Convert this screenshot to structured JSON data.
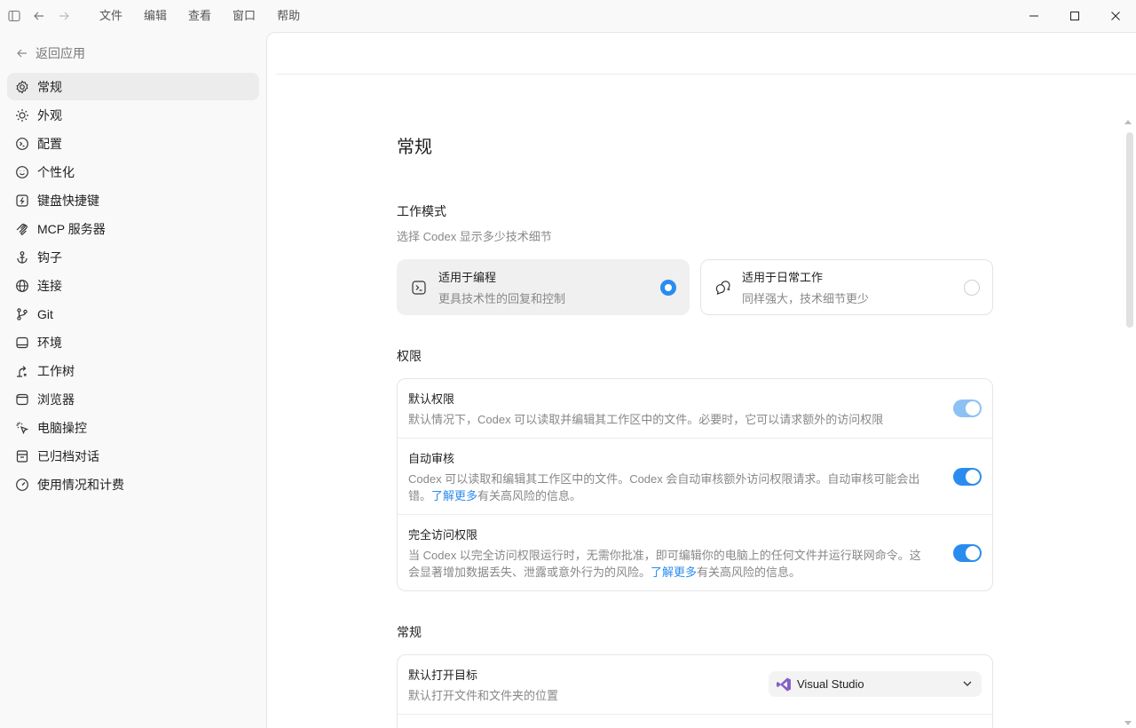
{
  "menu": [
    "文件",
    "编辑",
    "查看",
    "窗口",
    "帮助"
  ],
  "sidebar": {
    "back_label": "返回应用",
    "items": [
      {
        "label": "常规",
        "icon": "gear-icon"
      },
      {
        "label": "外观",
        "icon": "sun-icon"
      },
      {
        "label": "配置",
        "icon": "config-icon"
      },
      {
        "label": "个性化",
        "icon": "personalize-icon"
      },
      {
        "label": "键盘快捷键",
        "icon": "keyboard-icon"
      },
      {
        "label": "MCP 服务器",
        "icon": "mcp-icon"
      },
      {
        "label": "钩子",
        "icon": "anchor-icon"
      },
      {
        "label": "连接",
        "icon": "globe-icon"
      },
      {
        "label": "Git",
        "icon": "git-branch-icon"
      },
      {
        "label": "环境",
        "icon": "environment-icon"
      },
      {
        "label": "工作树",
        "icon": "worktree-icon"
      },
      {
        "label": "浏览器",
        "icon": "browser-icon"
      },
      {
        "label": "电脑操控",
        "icon": "cursor-click-icon"
      },
      {
        "label": "已归档对话",
        "icon": "archive-icon"
      },
      {
        "label": "使用情况和计费",
        "icon": "gauge-icon"
      }
    ]
  },
  "main": {
    "title": "常规",
    "work_mode": {
      "title": "工作模式",
      "subtitle": "选择 Codex 显示多少技术细节",
      "options": [
        {
          "title": "适用于编程",
          "desc": "更具技术性的回复和控制",
          "selected": true
        },
        {
          "title": "适用于日常工作",
          "desc": "同样强大，技术细节更少",
          "selected": false
        }
      ]
    },
    "permissions": {
      "title": "权限",
      "rows": [
        {
          "title": "默认权限",
          "desc": "默认情况下，Codex 可以读取并编辑其工作区中的文件。必要时，它可以请求额外的访问权限",
          "on": true
        },
        {
          "title": "自动审核",
          "desc": "Codex 可以读取和编辑其工作区中的文件。Codex 会自动审核额外访问权限请求。自动审核可能会出错。",
          "link": "了解更多",
          "after": "有关高风险的信息。",
          "on": true
        },
        {
          "title": "完全访问权限",
          "desc": "当 Codex 以完全访问权限运行时，无需你批准，即可编辑你的电脑上的任何文件并运行联网命令。这会显著增加数据丢失、泄露或意外行为的风险。",
          "link": "了解更多",
          "after": "有关高风险的信息。",
          "on": true
        }
      ]
    },
    "general": {
      "title": "常规",
      "rows": [
        {
          "title": "默认打开目标",
          "desc": "默认打开文件和文件夹的位置",
          "value": "Visual Studio"
        }
      ]
    }
  },
  "colors": {
    "accent": "#2b8cf0",
    "selected_bg": "#f0f0f0",
    "sidebar_active": "#ececec"
  }
}
